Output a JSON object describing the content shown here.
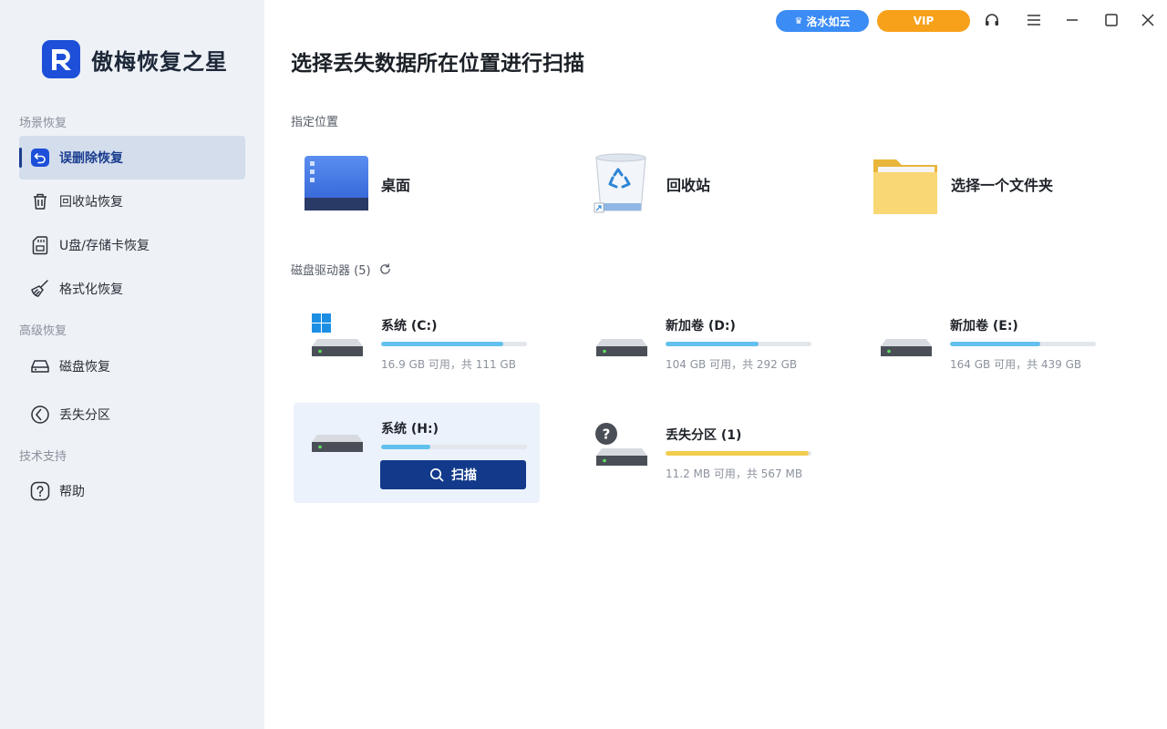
{
  "app": {
    "name": "傲梅恢复之星"
  },
  "titlebar": {
    "user_label": "洛水如云",
    "vip_label": "VIP",
    "icons": [
      "headset-icon",
      "menu-icon",
      "minimize-icon",
      "maximize-icon",
      "close-icon"
    ]
  },
  "sidebar": {
    "groups": [
      {
        "title": "场景恢复",
        "items": [
          {
            "label": "误删除恢复",
            "icon": "undo-icon",
            "active": true
          },
          {
            "label": "回收站恢复",
            "icon": "trash-icon"
          },
          {
            "label": "U盘/存储卡恢复",
            "icon": "sd-card-icon"
          },
          {
            "label": "格式化恢复",
            "icon": "broom-icon"
          }
        ]
      },
      {
        "title": "高级恢复",
        "items": [
          {
            "label": "磁盘恢复",
            "icon": "disk-icon"
          },
          {
            "label": "丢失分区",
            "icon": "partition-icon"
          }
        ]
      },
      {
        "title": "技术支持",
        "items": [
          {
            "label": "帮助",
            "icon": "help-icon"
          }
        ]
      }
    ]
  },
  "main": {
    "title": "选择丢失数据所在位置进行扫描",
    "locations_title": "指定位置",
    "locations": [
      {
        "label": "桌面",
        "icon": "desktop-icon"
      },
      {
        "label": "回收站",
        "icon": "recycle-bin-icon"
      },
      {
        "label": "选择一个文件夹",
        "icon": "folder-icon"
      }
    ],
    "drives_title": "磁盘驱动器 (5)",
    "drives": [
      {
        "name": "系统 (C:)",
        "size": "16.9 GB 可用，共 111 GB",
        "used_fraction": 0.84,
        "windows": true
      },
      {
        "name": "新加卷 (D:)",
        "size": "104 GB 可用，共 292 GB",
        "used_fraction": 0.64
      },
      {
        "name": "新加卷 (E:)",
        "size": "164 GB 可用，共 439 GB",
        "used_fraction": 0.62
      },
      {
        "name": "系统 (H:)",
        "used_fraction": 0.34,
        "selected": true,
        "scan_label": "扫描"
      },
      {
        "name": "丢失分区 (1)",
        "size": "11.2 MB 可用，共 567 MB",
        "used_fraction": 0.98,
        "lost": true
      }
    ]
  },
  "colors": {
    "accent": "#12398a",
    "sidebar_bg": "#eef1f6",
    "bar_blue": "#62c0ee",
    "bar_yellow": "#f2cc4e",
    "vip": "#f7a11a",
    "user_pill": "#3b8cf5"
  }
}
